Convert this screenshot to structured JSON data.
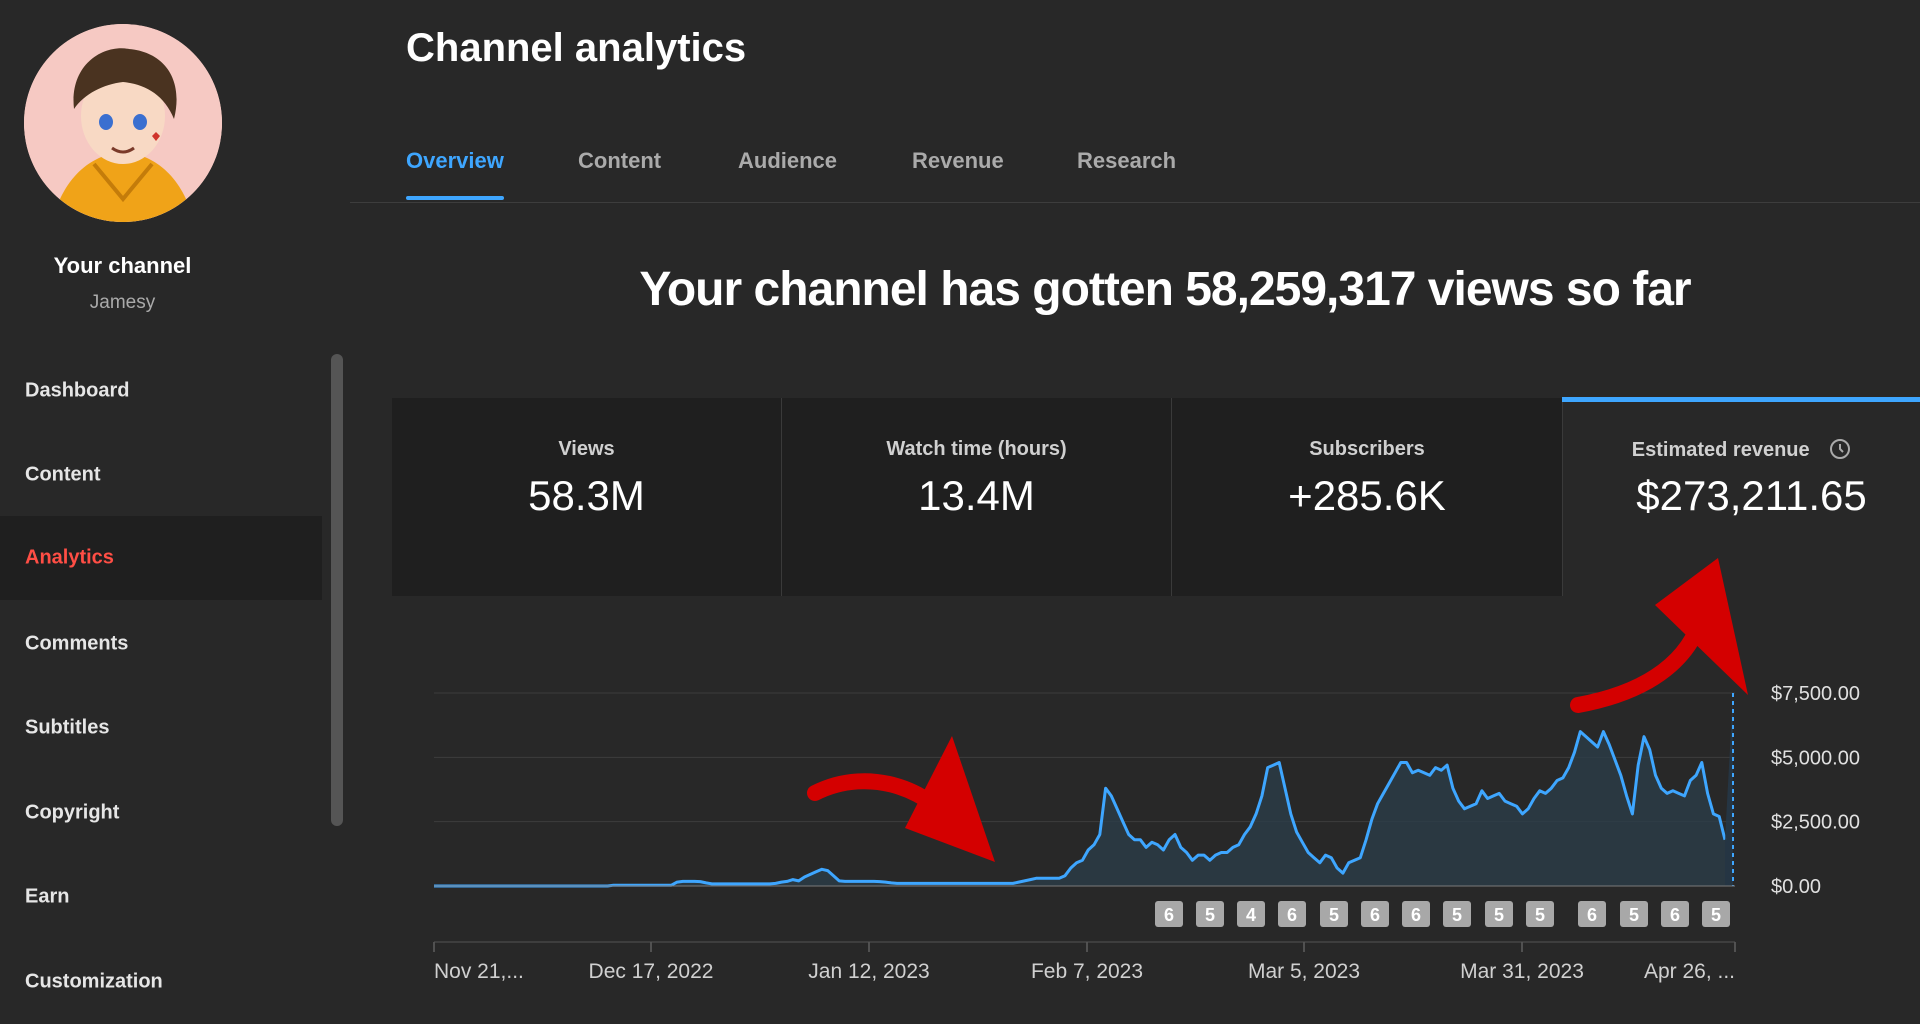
{
  "sidebar": {
    "channel_title": "Your channel",
    "channel_handle": "Jamesy",
    "items": [
      {
        "label": "Dashboard"
      },
      {
        "label": "Content"
      },
      {
        "label": "Analytics"
      },
      {
        "label": "Comments"
      },
      {
        "label": "Subtitles"
      },
      {
        "label": "Copyright"
      },
      {
        "label": "Earn"
      },
      {
        "label": "Customization"
      }
    ],
    "active_item": "Analytics"
  },
  "header": {
    "title": "Channel analytics",
    "tabs": [
      {
        "label": "Overview"
      },
      {
        "label": "Content"
      },
      {
        "label": "Audience"
      },
      {
        "label": "Revenue"
      },
      {
        "label": "Research"
      }
    ],
    "active_tab": "Overview"
  },
  "headline": "Your channel has gotten 58,259,317 views so far",
  "metrics": [
    {
      "label": "Views",
      "value": "58.3M"
    },
    {
      "label": "Watch time (hours)",
      "value": "13.4M"
    },
    {
      "label": "Subscribers",
      "value": "+285.6K"
    },
    {
      "label": "Estimated revenue",
      "value": "$273,211.65",
      "selected": true
    }
  ],
  "colors": {
    "background": "#282828",
    "accent_blue": "#3ea6ff",
    "active_nav_red": "#ff4e45",
    "line": "#3ea6ff",
    "arrow_red": "#d40000"
  },
  "icons": [
    "clock-icon"
  ],
  "chart_data": {
    "type": "area",
    "ylabel": "",
    "yticks": [
      "$0.00",
      "$2,500.00",
      "$5,000.00",
      "$7,500.00"
    ],
    "ylim": [
      0,
      7500
    ],
    "xticks": [
      "Nov 21,...",
      "Dec 17, 2022",
      "Jan 12, 2023",
      "Feb 7, 2023",
      "Mar 5, 2023",
      "Mar 31, 2023",
      "Apr 26, ..."
    ],
    "x_start": "2022-11-21",
    "x_end": "2023-04-28",
    "values": [
      0,
      0,
      0,
      0,
      0,
      0,
      0,
      0,
      0,
      0,
      0,
      0,
      0,
      0,
      0,
      0,
      0,
      0,
      0,
      0,
      0,
      0,
      0,
      0,
      0,
      0,
      0,
      0,
      0,
      0,
      0,
      30,
      30,
      30,
      30,
      30,
      30,
      30,
      30,
      30,
      30,
      30,
      150,
      180,
      180,
      180,
      170,
      120,
      80,
      80,
      80,
      80,
      80,
      80,
      80,
      80,
      80,
      80,
      80,
      100,
      150,
      180,
      250,
      200,
      350,
      450,
      550,
      650,
      600,
      400,
      200,
      180,
      180,
      180,
      180,
      180,
      180,
      170,
      150,
      120,
      100,
      100,
      100,
      100,
      100,
      100,
      100,
      100,
      100,
      100,
      100,
      100,
      100,
      100,
      100,
      100,
      100,
      100,
      100,
      100,
      100,
      150,
      200,
      250,
      300,
      300,
      300,
      300,
      300,
      400,
      700,
      900,
      1000,
      1400,
      1600,
      2000,
      3800,
      3500,
      3000,
      2500,
      2000,
      1800,
      1800,
      1500,
      1700,
      1600,
      1400,
      1800,
      2000,
      1500,
      1300,
      1000,
      1200,
      1200,
      1000,
      1200,
      1300,
      1300,
      1500,
      1600,
      2000,
      2300,
      2800,
      3500,
      4600,
      4700,
      4800,
      3800,
      2800,
      2100,
      1700,
      1300,
      1100,
      900,
      1200,
      1100,
      700,
      500,
      900,
      1000,
      1100,
      1800,
      2600,
      3200,
      3600,
      4000,
      4400,
      4800,
      4800,
      4400,
      4500,
      4400,
      4300,
      4600,
      4500,
      4700,
      3800,
      3300,
      3000,
      3100,
      3200,
      3700,
      3400,
      3500,
      3600,
      3300,
      3200,
      3100,
      2800,
      3000,
      3400,
      3700,
      3600,
      3800,
      4100,
      4200,
      4600,
      5200,
      6000,
      5800,
      5600,
      5400,
      6000,
      5500,
      4900,
      4300,
      3500,
      2800,
      4700,
      5800,
      5300,
      4300,
      3800,
      3600,
      3700,
      3600,
      3500,
      4100,
      4300,
      4800,
      3600,
      2800,
      2700,
      1800
    ],
    "projected_last_value": 7500,
    "weekly_markers": [
      "6",
      "5",
      "4",
      "6",
      "5",
      "6",
      "6",
      "5",
      "5",
      "5",
      "6",
      "5",
      "6",
      "5"
    ],
    "grid": true
  }
}
